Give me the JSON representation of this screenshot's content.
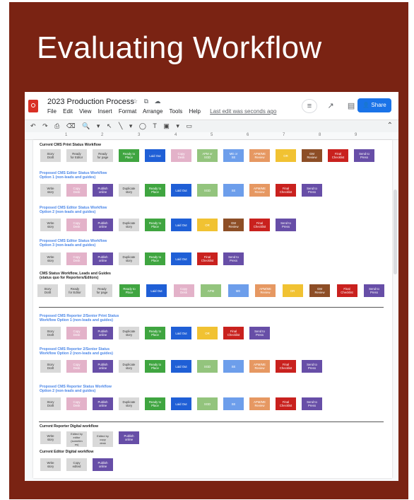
{
  "slide_title": "Evaluating Workflow",
  "doc": {
    "name": "2023 Production Process",
    "title_icons": [
      "☆",
      "⧉",
      "☁"
    ],
    "menus": [
      "File",
      "Edit",
      "View",
      "Insert",
      "Format",
      "Arrange",
      "Tools",
      "Help"
    ],
    "last_edit": "Last edit was seconds ago",
    "share_label": "Share",
    "toolbar_icons": [
      "↶",
      "↷",
      "⎙",
      "⌫",
      "🔍",
      "▾",
      "↖",
      "╲",
      "▾",
      "◯",
      "T",
      "▣",
      "▾",
      "▭"
    ],
    "ruler": [
      "1",
      "2",
      "3",
      "4",
      "5",
      "6",
      "7",
      "8",
      "9"
    ]
  },
  "sections": [
    {
      "title": "Current CMS Print Status Workflow",
      "color": "k",
      "items": [
        {
          "t": "Story\nDraft",
          "c": "gray"
        },
        {
          "t": "Ready\nfor Editor",
          "c": "gray"
        },
        {
          "t": "Ready\nfor page",
          "c": "gray"
        },
        {
          "t": "Ready to\nPlace",
          "c": "green"
        },
        {
          "t": "Laid Out",
          "c": "blue"
        },
        {
          "t": "Copy\nDesk",
          "c": "pink"
        },
        {
          "t": "APM or\nSGD",
          "c": "lgreen"
        },
        {
          "t": "ME or\nSE",
          "c": "lblue"
        },
        {
          "t": "APM/ME\nReview",
          "c": "orange"
        },
        {
          "t": "OR",
          "c": "yellow"
        },
        {
          "t": "GM\nReview",
          "c": "brown"
        },
        {
          "t": "Final\nChecklist",
          "c": "red"
        },
        {
          "t": "Send to\nPress",
          "c": "purple"
        }
      ]
    },
    {
      "title": "Proposed CMS Editor Status Workflow\nOption 1  (non-leads and guides)",
      "color": "b",
      "items": [
        {
          "t": "Write\nstory",
          "c": "gray"
        },
        {
          "t": "Copy\nDesk",
          "c": "pink"
        },
        {
          "t": "Publish\nonline",
          "c": "purple"
        },
        {
          "t": "Duplicate\nstory",
          "c": "gray"
        },
        {
          "t": "Ready to\nPlace",
          "c": "green"
        },
        {
          "t": "Laid Out",
          "c": "blue"
        },
        {
          "t": "SGD",
          "c": "lgreen"
        },
        {
          "t": "SE",
          "c": "lblue"
        },
        {
          "t": "APM/ME\nReview",
          "c": "orange"
        },
        {
          "t": "Final\nChecklist",
          "c": "red"
        },
        {
          "t": "Send to\nPress",
          "c": "purple"
        }
      ]
    },
    {
      "title": "Proposed CMS Editor Status Workflow\nOption 2  (non-leads and guides)",
      "color": "b",
      "items": [
        {
          "t": "Write\nstory",
          "c": "gray"
        },
        {
          "t": "Copy\nDesk",
          "c": "pink"
        },
        {
          "t": "Publish\nonline",
          "c": "purple"
        },
        {
          "t": "Duplicate\nstory",
          "c": "gray"
        },
        {
          "t": "Ready to\nPlace",
          "c": "green"
        },
        {
          "t": "Laid Out",
          "c": "blue"
        },
        {
          "t": "OR",
          "c": "yellow"
        },
        {
          "t": "GM\nReview",
          "c": "brown"
        },
        {
          "t": "Final\nChecklist",
          "c": "red"
        },
        {
          "t": "Send to\nPress",
          "c": "purple"
        }
      ]
    },
    {
      "title": "Proposed CMS Editor Status Workflow\nOption 3  (non-leads and guides)",
      "color": "b",
      "items": [
        {
          "t": "Write\nstory",
          "c": "gray"
        },
        {
          "t": "Copy\nDesk",
          "c": "pink"
        },
        {
          "t": "Publish\nonline",
          "c": "purple"
        },
        {
          "t": "Duplicate\nstory",
          "c": "gray"
        },
        {
          "t": "Ready to\nPlace",
          "c": "green"
        },
        {
          "t": "Laid Out",
          "c": "blue"
        },
        {
          "t": "Final\nChecklist",
          "c": "red"
        },
        {
          "t": "Send to\nPress",
          "c": "purple"
        }
      ]
    },
    {
      "title": "CMS Status Workflow, Leads and Guides\n(status quo for Reporters/Editors)",
      "color": "k",
      "items": [
        {
          "t": "Story\nDraft",
          "c": "gray"
        },
        {
          "t": "Ready\nfor Editor",
          "c": "gray"
        },
        {
          "t": "Ready\nfor page",
          "c": "gray"
        },
        {
          "t": "Ready to\nPlace",
          "c": "green"
        },
        {
          "t": "Laid Out",
          "c": "blue"
        },
        {
          "t": "Copy\nDesk",
          "c": "pink"
        },
        {
          "t": "APM",
          "c": "lgreen"
        },
        {
          "t": "ME",
          "c": "lblue"
        },
        {
          "t": "APM/ME\nReview",
          "c": "orange"
        },
        {
          "t": "OR",
          "c": "yellow"
        },
        {
          "t": "GM\nReview",
          "c": "brown"
        },
        {
          "t": "Final\nChecklist",
          "c": "red"
        },
        {
          "t": "Send to\nPress",
          "c": "purple"
        }
      ]
    },
    {
      "title": "Proposed CMS Reporter 2/Senior Print Status\nWorkflow Option 1 (non-leads and guides)",
      "color": "b",
      "items": [
        {
          "t": "Story\nDraft",
          "c": "gray"
        },
        {
          "t": "Copy\nDesk",
          "c": "pink"
        },
        {
          "t": "Publish\nonline",
          "c": "purple"
        },
        {
          "t": "Duplicate\nstory",
          "c": "gray"
        },
        {
          "t": "Ready to\nPlace",
          "c": "green"
        },
        {
          "t": "Laid Out",
          "c": "blue"
        },
        {
          "t": "OR",
          "c": "yellow"
        },
        {
          "t": "Final\nChecklist",
          "c": "red"
        },
        {
          "t": "Send to\nPress",
          "c": "purple"
        }
      ]
    },
    {
      "title": "Proposed CMS Reporter 2/Senior Status\nWorkflow Option 2  (non-leads and guides)",
      "color": "b",
      "items": [
        {
          "t": "Story\nDraft",
          "c": "gray"
        },
        {
          "t": "Copy\nDesk",
          "c": "pink"
        },
        {
          "t": "Publish\nonline",
          "c": "purple"
        },
        {
          "t": "Duplicate\nstory",
          "c": "gray"
        },
        {
          "t": "Ready to\nPlace",
          "c": "green"
        },
        {
          "t": "Laid Out",
          "c": "blue"
        },
        {
          "t": "SGD",
          "c": "lgreen"
        },
        {
          "t": "SE",
          "c": "lblue"
        },
        {
          "t": "APM/ME\nReview",
          "c": "orange"
        },
        {
          "t": "Final\nChecklist",
          "c": "red"
        },
        {
          "t": "Send to\nPress",
          "c": "purple"
        }
      ]
    },
    {
      "title": "Proposed CMS Reporter Status Workflow\nOption 2  (non-leads and guides)",
      "color": "b",
      "items": [
        {
          "t": "Story\nDraft",
          "c": "gray"
        },
        {
          "t": "Copy\nDesk",
          "c": "pink"
        },
        {
          "t": "Publish\nonline",
          "c": "purple"
        },
        {
          "t": "Duplicate\nstory",
          "c": "gray"
        },
        {
          "t": "Ready to\nPlace",
          "c": "green"
        },
        {
          "t": "Laid Out",
          "c": "blue"
        },
        {
          "t": "SGD",
          "c": "lgreen"
        },
        {
          "t": "SE",
          "c": "lblue"
        },
        {
          "t": "APM/ME\nReview",
          "c": "orange"
        },
        {
          "t": "Final\nChecklist",
          "c": "red"
        },
        {
          "t": "Send to\nPress",
          "c": "purple"
        }
      ]
    },
    {
      "title": "Current Reporter Digital workflow",
      "color": "k",
      "items": [
        {
          "t": "Write\nstory",
          "c": "gray"
        },
        {
          "t": "Edited by\neditor\n(sometim\nes)",
          "c": "gray"
        },
        {
          "t": "Edited by\ncopy\ndesk",
          "c": "gray"
        },
        {
          "t": "Publish\nonline",
          "c": "purple"
        }
      ]
    },
    {
      "title": "Current Editor Digital workflow",
      "color": "k",
      "items": [
        {
          "t": "Write\nstory",
          "c": "gray"
        },
        {
          "t": "Copy\nedited",
          "c": "gray"
        },
        {
          "t": "Publish\nonline",
          "c": "purple"
        }
      ]
    }
  ]
}
